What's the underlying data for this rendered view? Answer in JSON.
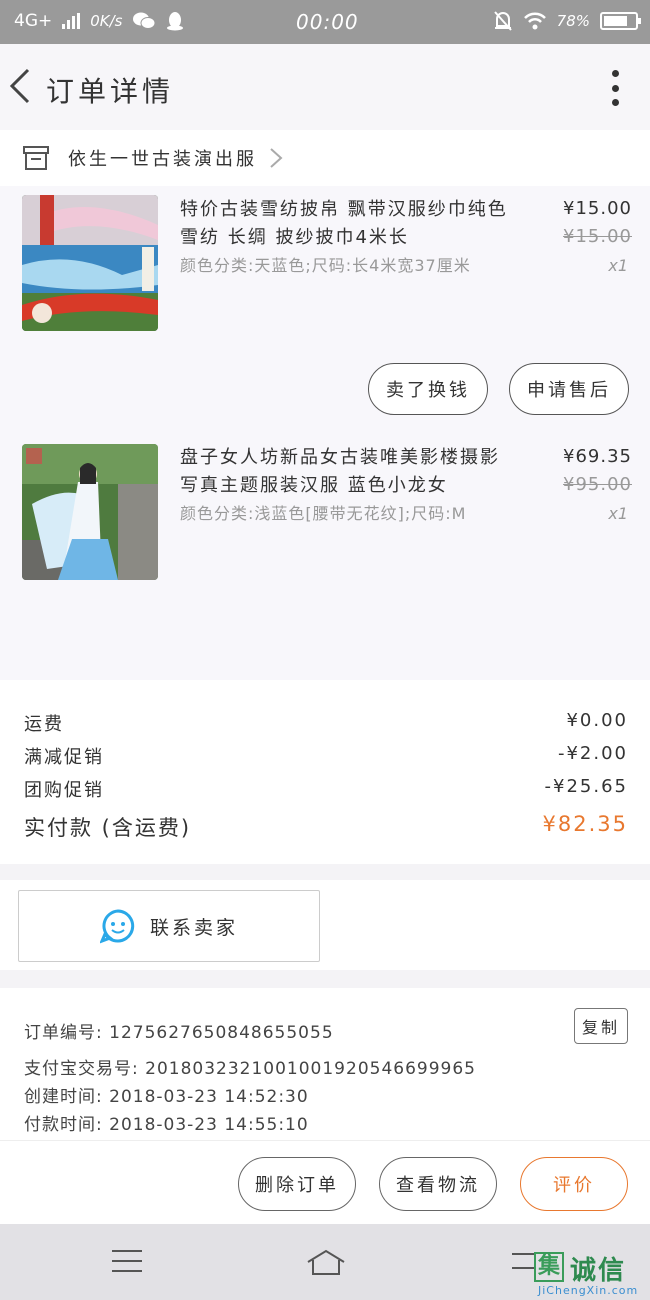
{
  "status_bar": {
    "network": "4G+",
    "speed": "0K/s",
    "time": "00:00",
    "battery": "78%",
    "battery_level": 0.78
  },
  "header": {
    "title": "订单详情"
  },
  "shop": {
    "name": "依生一世古装演出服"
  },
  "products": [
    {
      "title": "特价古装雪纺披帛 飘带汉服纱巾纯色雪纺 长绸 披纱披巾4米长",
      "spec": "颜色分类:天蓝色;尺码:长4米宽37厘米",
      "price": "¥15.00",
      "original_price": "¥15.00",
      "quantity": "x1",
      "actions": [
        "卖了换钱",
        "申请售后"
      ]
    },
    {
      "title": "盘子女人坊新品女古装唯美影楼摄影写真主题服装汉服 蓝色小龙女",
      "spec": "颜色分类:浅蓝色[腰带无花纹];尺码:M",
      "price": "¥69.35",
      "original_price": "¥95.00",
      "quantity": "x1"
    }
  ],
  "fees": [
    {
      "label": "运费",
      "value": "¥0.00"
    },
    {
      "label": "满减促销",
      "value": "-¥2.00"
    },
    {
      "label": "团购促销",
      "value": "-¥25.65"
    }
  ],
  "total": {
    "label": "实付款 (含运费)",
    "value": "¥82.35"
  },
  "contact": {
    "label": "联系卖家"
  },
  "order_info": {
    "order_no": "订单编号: 1275627650848655055",
    "alipay_no": "支付宝交易号: 2018032321001001920546699965",
    "created": "创建时间: 2018-03-23 14:52:30",
    "paid": "付款时间: 2018-03-23 14:55:10",
    "copy_label": "复制"
  },
  "actions": {
    "delete": "删除订单",
    "logistics": "查看物流",
    "review": "评价"
  },
  "watermark": {
    "name": "诚信",
    "url": "JiChengXin.com"
  },
  "colors": {
    "accent": "#e8782f",
    "status_bar": "#9a9a9a",
    "contact_icon": "#2aa8e8"
  }
}
